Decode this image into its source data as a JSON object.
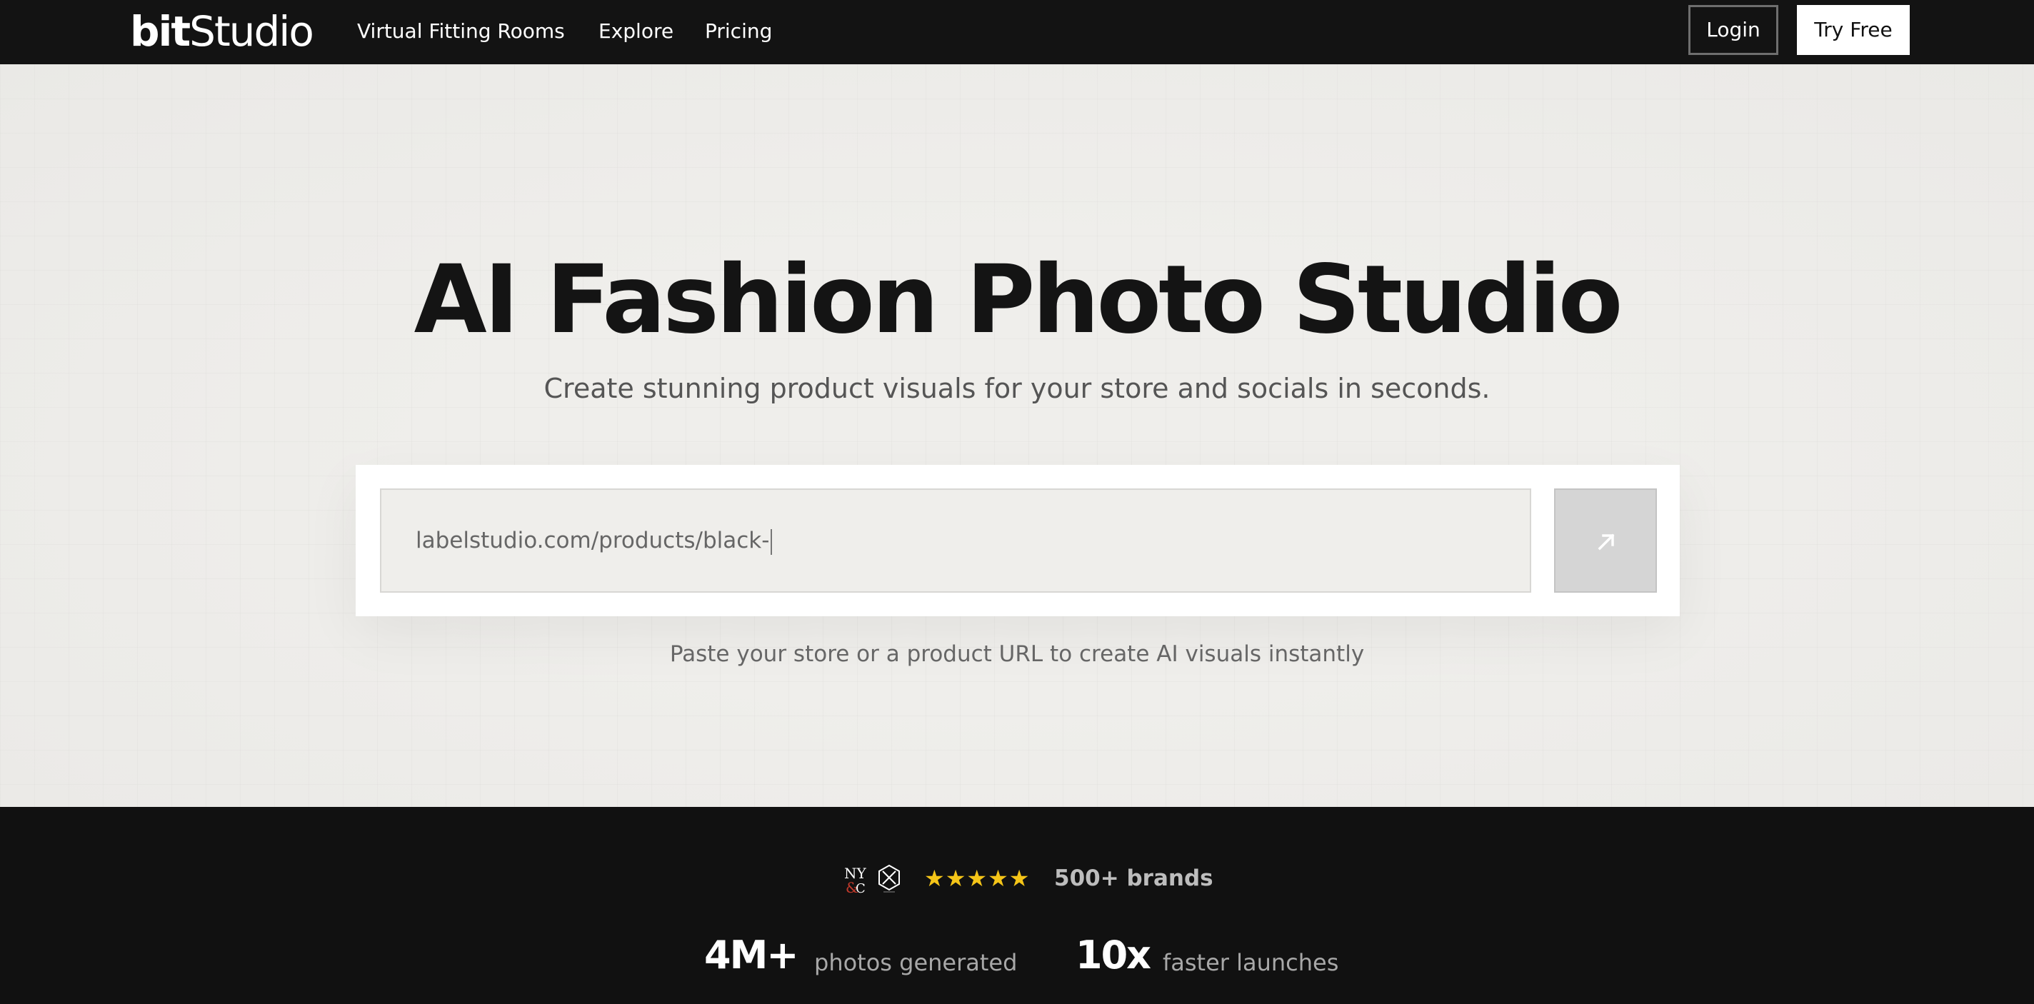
{
  "nav": {
    "brand_bold": "bit",
    "brand_light": "Studio",
    "links": [
      {
        "label": "Virtual Fitting Rooms"
      },
      {
        "label": "Explore"
      },
      {
        "label": "Pricing"
      }
    ],
    "login_label": "Login",
    "try_free_label": "Try Free"
  },
  "hero": {
    "title": "AI Fashion Photo Studio",
    "subtitle": "Create stunning product visuals for your store and socials in seconds.",
    "url_input_value": "labelstudio.com/products/black-",
    "submit_icon": "arrow-up-right-icon",
    "hint": "Paste your store or a product URL to create AI visuals instantly"
  },
  "stats": {
    "rating_stars": 5,
    "stars_display": "★★★★★",
    "brands_label": "500+ brands",
    "items": [
      {
        "value": "4M+",
        "label": "photos generated"
      },
      {
        "value": "10x",
        "label": "faster launches"
      }
    ]
  },
  "colors": {
    "nav_bg": "#131313",
    "hero_bg": "#efeeeb",
    "stats_bg": "#111111",
    "star": "#f5c518"
  }
}
